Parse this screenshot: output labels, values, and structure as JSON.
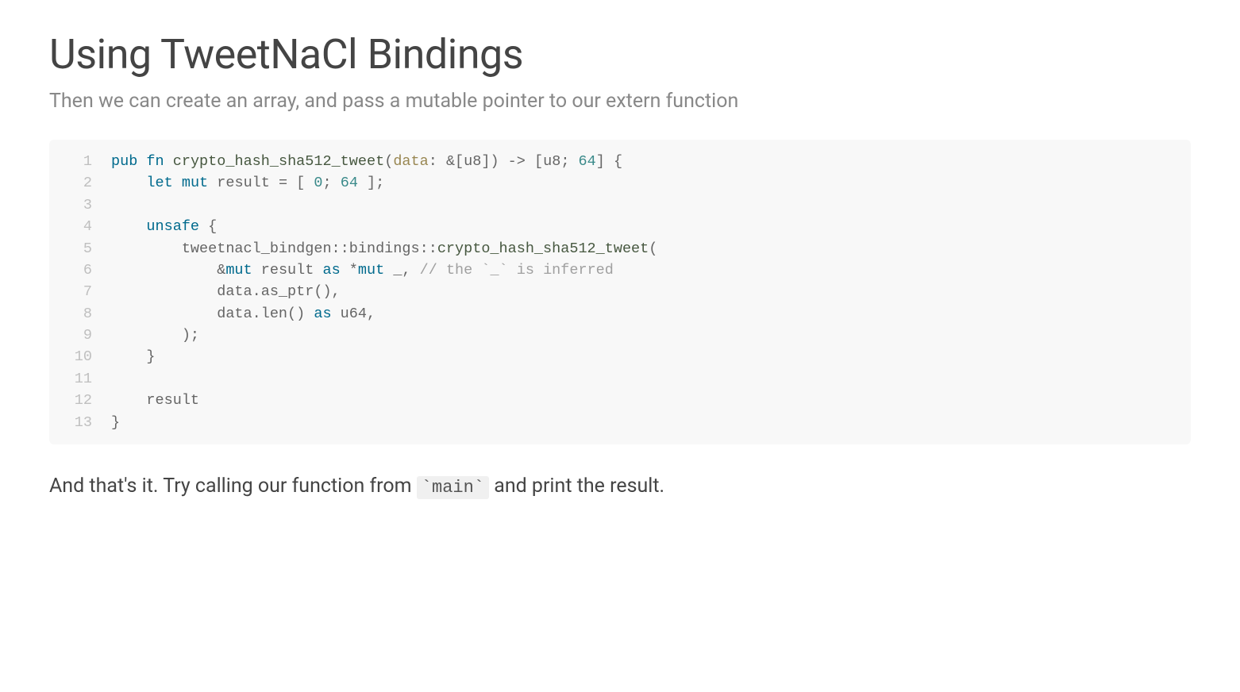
{
  "title": "Using TweetNaCl Bindings",
  "subtitle": "Then we can create an array, and pass a mutable pointer to our extern function",
  "code": {
    "lines": [
      {
        "n": "1",
        "tokens": [
          [
            "kw-vis",
            "pub"
          ],
          [
            "",
            ". "
          ],
          [
            "kw",
            "fn"
          ],
          [
            "",
            " "
          ],
          [
            "fn-name",
            "crypto_hash_sha512_tweet"
          ],
          [
            "op",
            "("
          ],
          [
            "param",
            "data"
          ],
          [
            "op",
            ": &["
          ],
          [
            "type",
            "u8"
          ],
          [
            "op",
            "]) -> ["
          ],
          [
            "type",
            "u8"
          ],
          [
            "op",
            "; "
          ],
          [
            "num",
            "64"
          ],
          [
            "op",
            "] {"
          ]
        ]
      },
      {
        "n": "2",
        "tokens": [
          [
            "",
            "    "
          ],
          [
            "kw-let",
            "let"
          ],
          [
            "",
            " "
          ],
          [
            "kw",
            "mut"
          ],
          [
            "",
            " result = [ "
          ],
          [
            "num",
            "0"
          ],
          [
            "op",
            "; "
          ],
          [
            "num",
            "64"
          ],
          [
            "op",
            " ];"
          ]
        ]
      },
      {
        "n": "3",
        "tokens": [
          [
            "",
            ""
          ]
        ]
      },
      {
        "n": "4",
        "tokens": [
          [
            "",
            "    "
          ],
          [
            "kw",
            "unsafe"
          ],
          [
            "op",
            " {"
          ]
        ]
      },
      {
        "n": "5",
        "tokens": [
          [
            "",
            "        tweetnacl_bindgen"
          ],
          [
            "op",
            "::"
          ],
          [
            "",
            "bindings"
          ],
          [
            "op",
            "::"
          ],
          [
            "fn-name",
            "crypto_hash_sha512_tweet"
          ],
          [
            "op",
            "("
          ]
        ]
      },
      {
        "n": "6",
        "tokens": [
          [
            "",
            "            &"
          ],
          [
            "kw",
            "mut"
          ],
          [
            "",
            " result "
          ],
          [
            "kw",
            "as"
          ],
          [
            "",
            " *"
          ],
          [
            "kw",
            "mut"
          ],
          [
            "",
            " _, "
          ],
          [
            "comment",
            "// the `_` is inferred"
          ]
        ]
      },
      {
        "n": "7",
        "tokens": [
          [
            "",
            "            data.as_ptr(),"
          ]
        ]
      },
      {
        "n": "8",
        "tokens": [
          [
            "",
            "            data.len() "
          ],
          [
            "kw",
            "as"
          ],
          [
            "",
            " "
          ],
          [
            "type",
            "u64"
          ],
          [
            "op",
            ","
          ]
        ]
      },
      {
        "n": "9",
        "tokens": [
          [
            "",
            "        );"
          ]
        ]
      },
      {
        "n": "10",
        "tokens": [
          [
            "",
            "    }"
          ]
        ]
      },
      {
        "n": "11",
        "tokens": [
          [
            "",
            ""
          ]
        ]
      },
      {
        "n": "12",
        "tokens": [
          [
            "",
            "    result"
          ]
        ]
      },
      {
        "n": "13",
        "tokens": [
          [
            "",
            "}"
          ]
        ]
      }
    ]
  },
  "footer": {
    "pre": "And that's it. Try calling our function from ",
    "code": "`main`",
    "post": " and print the result."
  }
}
